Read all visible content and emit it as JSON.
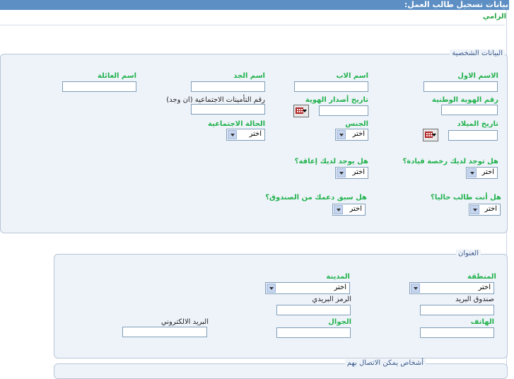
{
  "header": {
    "title": "بيانات تسجيل طالب العمل:"
  },
  "note": {
    "text": "الزامي"
  },
  "personal": {
    "legend": "البيانات الشخصية",
    "first_name_label": "الاسم الاول",
    "father_name_label": "اسم الاب",
    "grandfather_name_label": "اسم الجد",
    "family_name_label": "اسم العائلة",
    "national_id_label": "رقم الهوية الوطنية",
    "id_issue_date_label": "تاريخ أصدار الهوية",
    "social_security_label": "رقم التأمينات الاجتماعية (ان وجد)",
    "birth_date_label": "تاريخ الميلاد",
    "gender_label": "الجنس",
    "gender_value": "اختر",
    "marital_status_label": "الحالة الاجتماعية",
    "marital_status_value": "اختر",
    "driving_license_label": "هل توجد لديك رخصة قيادة؟",
    "driving_license_value": "اختر",
    "disability_label": "هل يوجد لديك إعاقة؟",
    "disability_value": "اختر",
    "student_label": "هل أنت طالب حاليا؟",
    "student_value": "اختر",
    "fund_support_label": "هل سبق دعمك من الصندوق؟",
    "fund_support_value": "اختر"
  },
  "address": {
    "legend": "العنوان",
    "region_label": "المنطقة",
    "region_value": "اختر",
    "city_label": "المدينة",
    "city_value": "اختر",
    "po_box_label": "صندوق البريد",
    "postal_code_label": "الرمز البريدي",
    "phone_label": "الهاتف",
    "mobile_label": "الجوال",
    "email_label": "البريد الالكتروني"
  },
  "contacts": {
    "legend": "أشخاص يمكن الاتصال بهم"
  }
}
